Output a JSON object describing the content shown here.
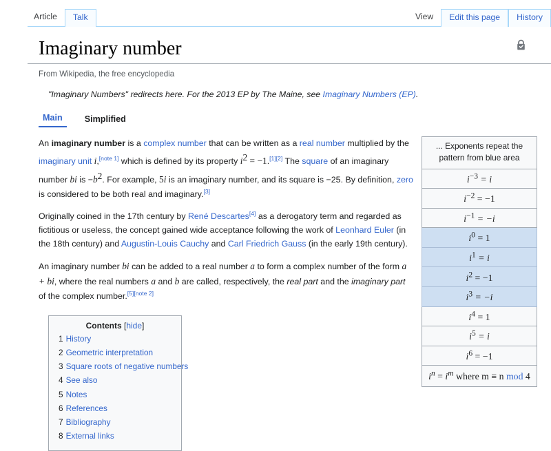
{
  "nav": {
    "namespace_tabs": [
      {
        "label": "Article",
        "state": "selected"
      },
      {
        "label": "Talk",
        "state": "tab"
      }
    ],
    "view_tabs": [
      {
        "label": "View",
        "state": "selected"
      },
      {
        "label": "Edit this page",
        "state": "tab"
      },
      {
        "label": "History",
        "state": "tab"
      }
    ]
  },
  "page": {
    "title": "Imaginary number",
    "subtitle": "From Wikipedia, the free encyclopedia",
    "protection_icon": "lock-icon"
  },
  "hatnote": {
    "text_before": "\"Imaginary Numbers\" redirects here. For the 2013 EP by The Maine, see ",
    "link": "Imaginary Numbers (EP)",
    "text_after": "."
  },
  "variant_tabs": [
    {
      "label": "Main",
      "active": true
    },
    {
      "label": "Simplified",
      "active": false
    }
  ],
  "paragraphs": {
    "p1": {
      "s1": "An ",
      "bold1": "imaginary number",
      "s2": " is a ",
      "link1": "complex number",
      "s3": " that can be written as a ",
      "link2": "real number",
      "s4": " multiplied by the ",
      "link3": "imaginary unit",
      "s5": " ",
      "math_i": "i",
      "ref_note1": "[note 1]",
      "s6": " which is defined by its property ",
      "math_isq": "i",
      "math_isq_exp": "2",
      "math_isq_rest": " = −1",
      "ref_1": "[1]",
      "ref_2": "[2]",
      "s7": " The ",
      "link4": "square",
      "s8": " of an imaginary number ",
      "math_bi": "bi",
      "s9": " is −",
      "math_b": "b",
      "math_b_exp": "2",
      "s10": ". For example, ",
      "math_5i_num": "5",
      "math_5i_i": "i",
      "s11": " is an imaginary number, and its square is −25. By definition, ",
      "link5": "zero",
      "s12": " is considered to be both real and imaginary.",
      "ref_3": "[3]"
    },
    "p2": {
      "s1": "Originally coined in the 17th century by ",
      "link1": "René Descartes",
      "ref_4": "[4]",
      "s2": " as a derogatory term and regarded as fictitious or useless, the concept gained wide acceptance following the work of ",
      "link2": "Leonhard Euler",
      "s3": " (in the 18th century) and ",
      "link3": "Augustin-Louis Cauchy",
      "s4": " and ",
      "link4": "Carl Friedrich Gauss",
      "s5": " (in the early 19th century)."
    },
    "p3": {
      "s1": "An imaginary number ",
      "math_bi": "bi",
      "s2": " can be added to a real number ",
      "math_a": "a",
      "s3": " to form a complex number of the form ",
      "math_apbi": "a + bi",
      "s4": ", where the real numbers ",
      "math_a2": "a",
      "s5": " and ",
      "math_b": "b",
      "s6": " are called, respectively, the ",
      "it1": "real part",
      "s7": " and the ",
      "it2": "imaginary part",
      "s8": " of the complex number.",
      "ref_5": "[5]",
      "ref_note2": "[note 2]"
    }
  },
  "toc": {
    "title": "Contents",
    "hide_bracket_open": "[",
    "hide_label": "hide",
    "hide_bracket_close": "]",
    "items": [
      {
        "number": "1",
        "label": "History"
      },
      {
        "number": "2",
        "label": "Geometric interpretation"
      },
      {
        "number": "3",
        "label": "Square roots of negative numbers"
      },
      {
        "number": "4",
        "label": "See also"
      },
      {
        "number": "5",
        "label": "Notes"
      },
      {
        "number": "6",
        "label": "References"
      },
      {
        "number": "7",
        "label": "Bibliography"
      },
      {
        "number": "8",
        "label": "External links"
      }
    ]
  },
  "exponent_table": {
    "header_line1": "... Exponents repeat the pattern",
    "header_line2": "from blue area",
    "rows": [
      {
        "base": "i",
        "exp": "−3",
        "rest": " = i",
        "rest_italic": true,
        "highlight": false
      },
      {
        "base": "i",
        "exp": "−2",
        "rest": " = −1",
        "rest_italic": false,
        "highlight": false
      },
      {
        "base": "i",
        "exp": "−1",
        "rest": " = −i",
        "rest_italic": true,
        "highlight": false
      },
      {
        "base": "i",
        "exp": "0",
        "rest": " = 1",
        "rest_italic": false,
        "highlight": true
      },
      {
        "base": "i",
        "exp": "1",
        "rest": " = i",
        "rest_italic": true,
        "highlight": true
      },
      {
        "base": "i",
        "exp": "2",
        "rest": " = −1",
        "rest_italic": false,
        "highlight": true
      },
      {
        "base": "i",
        "exp": "3",
        "rest": " = −i",
        "rest_italic": true,
        "highlight": true
      },
      {
        "base": "i",
        "exp": "4",
        "rest": " = 1",
        "rest_italic": false,
        "highlight": false
      },
      {
        "base": "i",
        "exp": "5",
        "rest": " = i",
        "rest_italic": true,
        "highlight": false
      },
      {
        "base": "i",
        "exp": "6",
        "rest": " = −1",
        "rest_italic": false,
        "highlight": false
      }
    ],
    "footer": {
      "base1": "i",
      "exp1": "n",
      "eq": " = ",
      "base2": "i",
      "exp2": "m",
      "where": " where m ≡ n ",
      "mod_link": "mod",
      "tail": " 4"
    }
  },
  "colors": {
    "link": "#3366cc",
    "tab_border": "#a7d7f9",
    "table_border": "#a2a9b1",
    "highlight_row": "#cedff2",
    "highlight_border": "#aabdd6",
    "text": "#202122",
    "subtle_text": "#54595d",
    "toc_bg": "#f8f9fa"
  }
}
